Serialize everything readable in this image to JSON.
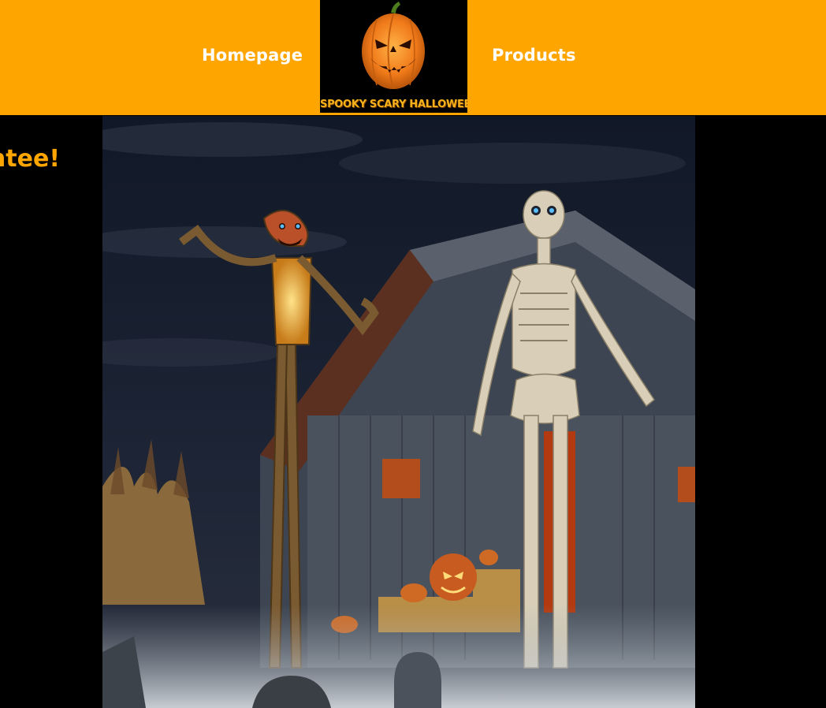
{
  "header": {
    "bg_color": "#ffa500",
    "nav": {
      "home_label": "Homepage",
      "products_label": "Products"
    },
    "logo": {
      "text": "SPOOKY SCARY HALLOWEEN",
      "icon": "jack-o-lantern-icon"
    }
  },
  "main": {
    "heading_partial": "ntee!",
    "heading_color": "#ffa500",
    "hero_image": {
      "subject": "giant-skeleton-decorations-barn-scene"
    }
  }
}
